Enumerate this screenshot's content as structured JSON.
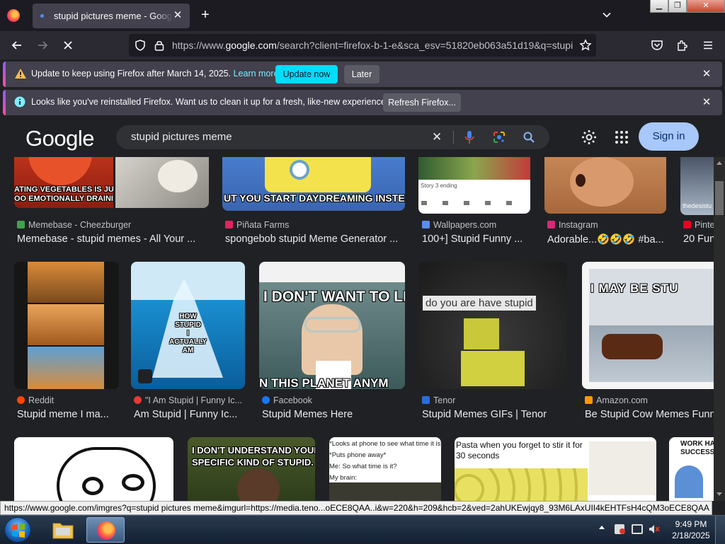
{
  "browser": {
    "tab_title": "stupid pictures meme - Google Search",
    "url_prefix": "https://www.",
    "url_domain": "google.com",
    "url_rest": "/search?client=firefox-b-1-e&sca_esv=51820eb063a51d19&q=stupid+pictures+meme",
    "new_tab_label": "+",
    "close_tab_label": "✕"
  },
  "notifications": {
    "update": {
      "message": "Update to keep using Firefox after March 14, 2025.",
      "link": "Learn more",
      "primary_button": "Update now",
      "secondary_button": "Later"
    },
    "refresh": {
      "message": "Looks like you've reinstalled Firefox. Want us to clean it up for a fresh, like-new experience?",
      "button": "Refresh Firefox..."
    },
    "close_label": "✕"
  },
  "google": {
    "logo": "Google",
    "query": "stupid pictures meme",
    "clear_label": "✕",
    "sign_in": "Sign in"
  },
  "results": {
    "row1": [
      {
        "source": "Memebase - Cheezburger",
        "title": "Memebase - stupid memes - All Your ...",
        "caption": "ATING VEGETABLES IS JUST\nOO EMOTIONALLY DRAINING",
        "fav": "#3fa34d"
      },
      {
        "source": "Piñata Farms",
        "title": "spongebob stupid Meme Generator ...",
        "caption": "UT YOU START DAYDREAMING INSTEAD",
        "fav": "#e0245e"
      },
      {
        "source": "Wallpapers.com",
        "title": "100+] Stupid Funny ...",
        "caption": "Story 3 ending",
        "fav": "#5b8def"
      },
      {
        "source": "Instagram",
        "title": "Adorable...🤣🤣🤣 #ba...",
        "caption": "",
        "fav": "#d62976"
      },
      {
        "source": "Pinte",
        "title": "20 Fun",
        "caption": "thedesistu",
        "fav": "#e60023"
      }
    ],
    "row2": [
      {
        "source": "Reddit",
        "title": "Stupid meme I ma...",
        "fav": "#ff4500"
      },
      {
        "source": "\"I Am Stupid | Funny Ic...",
        "title": "Am Stupid | Funny Ic...",
        "caption": "HOW\nSTUPID\nI\nACTUALLY\nAM",
        "fav": "#e53935"
      },
      {
        "source": "Facebook",
        "title": "Stupid Memes Here",
        "caption": "I DON'T WANT TO LIV",
        "caption2": "N THIS PLANET ANYM",
        "fav": "#1877f2"
      },
      {
        "source": "Tenor",
        "title": "Stupid Memes GIFs | Tenor",
        "caption": "do you are have stupid",
        "fav": "#2b6dd8"
      },
      {
        "source": "Amazon.com",
        "title": "Be Stupid Cow Memes Funn",
        "caption": "I MAY BE STU",
        "fav": "#ff9900"
      }
    ],
    "row3": [
      {
        "caption": ""
      },
      {
        "caption": "I DON'T UNDERSTAND YOUR\nSPECIFIC KIND OF STUPID."
      },
      {
        "caption": "*Looks at phone to see what time it is*\n*Puts phone away*\nMe: So what time is it?\nMy brain:"
      },
      {
        "caption": "Pasta when you forget to stir it for\n30 seconds"
      },
      {
        "caption": "WORK HA\nSUCCESS"
      }
    ]
  },
  "status_url": "https://www.google.com/imgres?q=stupid pictures meme&imgurl=https://media.teno...oECE8QAA..i&w=220&h=209&hcb=2&ved=2ahUKEwjqy8_93M6LAxUII4kEHTFsH4cQM3oECE8QAA",
  "taskbar": {
    "time": "9:49 PM",
    "date": "2/18/2025"
  }
}
